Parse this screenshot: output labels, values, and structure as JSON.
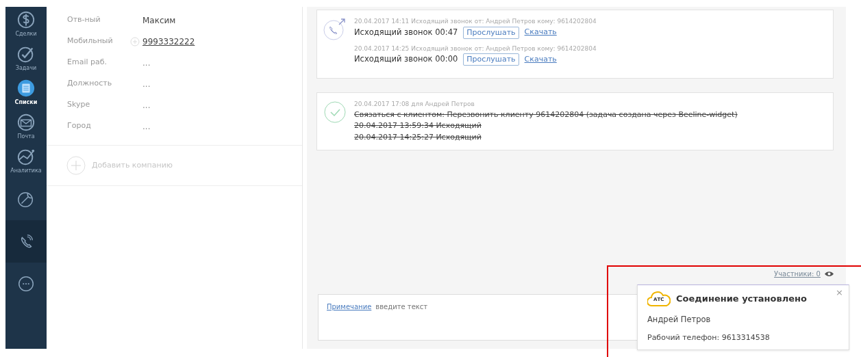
{
  "sidebar": {
    "items": [
      {
        "label": "Сделки",
        "selected": false
      },
      {
        "label": "Задачи",
        "selected": false
      },
      {
        "label": "Списки",
        "selected": true
      },
      {
        "label": "Почта",
        "selected": false
      },
      {
        "label": "Аналитика",
        "selected": false
      },
      {
        "selected": false
      },
      {
        "selected": true
      },
      {
        "selected": false
      }
    ]
  },
  "contact": {
    "fields": [
      {
        "label": "Отв-ный",
        "value": "Максим",
        "kind": "text"
      },
      {
        "label": "Мобильный",
        "value": "9993332222",
        "kind": "phone"
      },
      {
        "label": "Email раб.",
        "value": "...",
        "kind": "empty"
      },
      {
        "label": "Должность",
        "value": "...",
        "kind": "empty"
      },
      {
        "label": "Skype",
        "value": "...",
        "kind": "empty"
      },
      {
        "label": "Город",
        "value": "...",
        "kind": "empty"
      }
    ],
    "add_company": "Добавить компанию"
  },
  "feed": {
    "calls": [
      {
        "meta": "20.04.2017 14:11 Исходящий звонок от: Андрей Петров кому: 9614202804",
        "title": "Исходящий звонок 00:47",
        "listen": "Прослушать",
        "download": "Скачать"
      },
      {
        "meta": "20.04.2017 14:25 Исходящий звонок от: Андрей Петров кому: 9614202804",
        "title": "Исходящий звонок 00:00",
        "listen": "Прослушать",
        "download": "Скачать"
      }
    ],
    "task": {
      "meta": "20.04.2017 17:08 для Андрей Петров",
      "done": true,
      "lines": [
        "Связаться с клиентом: Перезвонить клиенту 9614202804 (задача создана через Beeline-widget)",
        "20.04.2017 13:59:34 Исходящий",
        "20.04.2017 14:25:27 Исходящий"
      ]
    },
    "participants": "Участники: 0",
    "note": {
      "label": "Примечание",
      "placeholder": "введите текст"
    }
  },
  "notification": {
    "logo_text": "АТС",
    "title": "Соединение установлено",
    "name": "Андрей Петров",
    "phone": "Рабочий телефон: 9613314538",
    "close": "×"
  }
}
